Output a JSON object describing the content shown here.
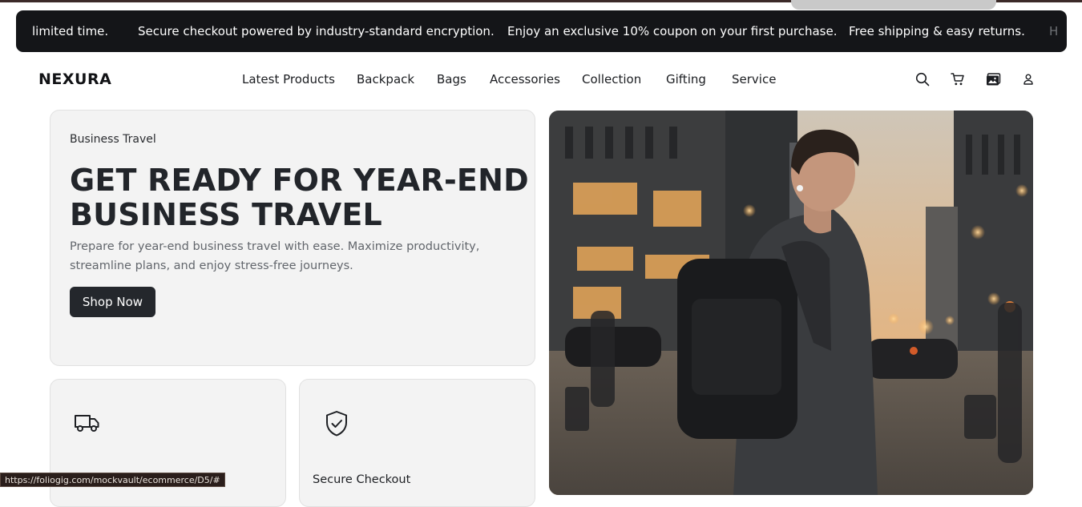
{
  "announcements": [
    "limited time.",
    "Secure checkout powered by industry-standard encryption.",
    "Enjoy an exclusive 10% coupon on your first purchase.",
    "Free shipping & easy returns.",
    "H"
  ],
  "brand": "NEXURA",
  "menu": [
    "Latest Products",
    "Backpack",
    "Bags",
    "Accessories",
    "Collection",
    "Gifting",
    "Service"
  ],
  "nav_icons": [
    "search-icon",
    "cart-icon",
    "gallery-icon",
    "user-icon"
  ],
  "hero": {
    "eyebrow": "Business Travel",
    "headline_line1": "GET READY FOR YEAR-END",
    "headline_line2": "BUSINESS TRAVEL",
    "description": "Prepare for year-end business travel with ease. Maximize productivity, streamline plans, and enjoy stress-free journeys.",
    "cta": "Shop Now"
  },
  "features": [
    {
      "icon": "truck-icon",
      "title": ""
    },
    {
      "icon": "shield-check-icon",
      "title": "Secure Checkout"
    }
  ],
  "status_bar_url": "https://foliogig.com/mockvault/ecommerce/D5/#",
  "colors": {
    "announce_bg": "#141518",
    "button_bg": "#24272c",
    "card_bg": "#f3f3f3"
  }
}
